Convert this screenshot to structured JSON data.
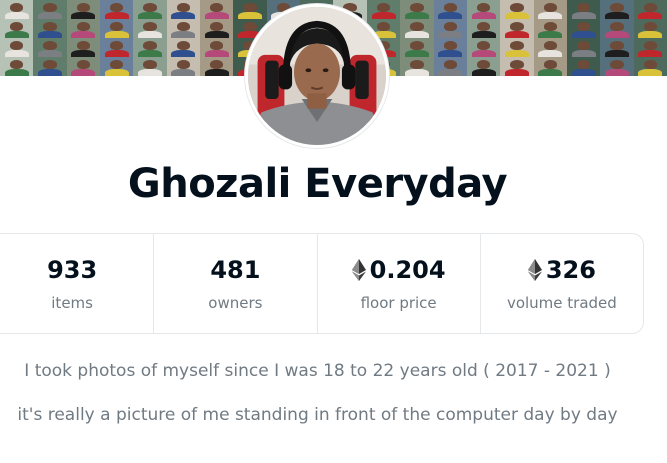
{
  "collection": {
    "name": "Ghozali Everyday"
  },
  "stats": [
    {
      "value": "933",
      "label": "items",
      "eth": false
    },
    {
      "value": "481",
      "label": "owners",
      "eth": false
    },
    {
      "value": "0.204",
      "label": "floor price",
      "eth": true
    },
    {
      "value": "326",
      "label": "volume traded",
      "eth": true
    }
  ],
  "description": {
    "line1": "I took photos of myself since I was 18 to 22 years old ( 2017 - 2021 )",
    "line2": "it's really a picture of me standing in front of the computer day by day"
  },
  "icons": {
    "currency": "ethereum-icon"
  },
  "colors": {
    "title": "#04111d",
    "muted": "#707a83",
    "border": "#e5e8eb"
  }
}
